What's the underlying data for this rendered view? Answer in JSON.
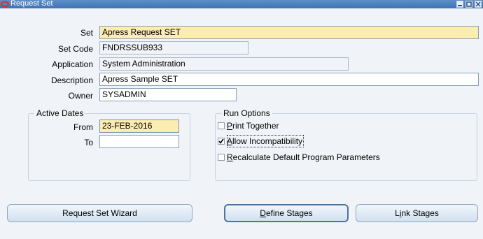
{
  "window": {
    "title": "Request Set",
    "controls": [
      "minimize",
      "maximize",
      "close"
    ]
  },
  "form": {
    "set": {
      "label": "Set",
      "value": "Apress Request SET"
    },
    "set_code": {
      "label": "Set Code",
      "value": "FNDRSSUB933"
    },
    "application": {
      "label": "Application",
      "value": "System Administration"
    },
    "description": {
      "label": "Description",
      "value": "Apress Sample SET"
    },
    "owner": {
      "label": "Owner",
      "value": "SYSADMIN"
    }
  },
  "active_dates": {
    "title": "Active Dates",
    "from": {
      "label": "From",
      "value": "23-FEB-2016"
    },
    "to": {
      "label": "To",
      "value": ""
    }
  },
  "run_options": {
    "title": "Run Options",
    "print_together": {
      "mnemonic": "P",
      "rest": "rint Together",
      "checked": false
    },
    "allow_incompatibility": {
      "mnemonic": "A",
      "rest": "llow Incompatibility",
      "checked": true
    },
    "recalculate": {
      "mnemonic": "R",
      "rest": "ecalculate Default Program Parameters",
      "checked": false
    }
  },
  "buttons": {
    "wizard": "Request Set Wizard",
    "define_mnemonic": "D",
    "define_rest": "efine Stages",
    "link_pre": "L",
    "link_mnemonic": "i",
    "link_rest": "nk Stages"
  },
  "colors": {
    "required_bg": "#fbecb0",
    "titlebar": "#4a7fbe",
    "window_bg": "#f0f3f7"
  }
}
